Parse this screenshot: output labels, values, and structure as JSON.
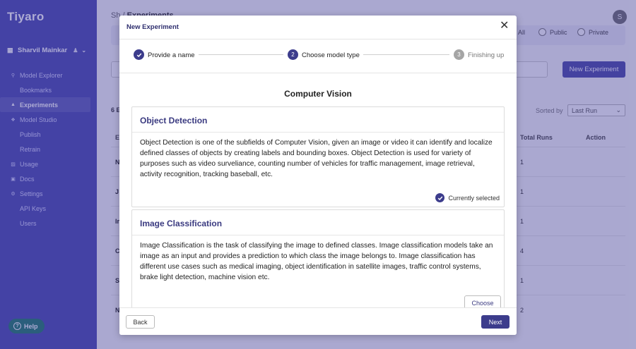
{
  "sidebar": {
    "brand": "Tiyaro",
    "user_name": "Sharvil Mainkar",
    "user_icon": "building-icon",
    "nav": [
      {
        "label": "Model Explorer",
        "icon": "search-icon",
        "sub": false,
        "active": false
      },
      {
        "label": "Bookmarks",
        "icon": "",
        "sub": true,
        "active": false
      },
      {
        "label": "Experiments",
        "icon": "flask-icon",
        "sub": false,
        "active": true
      },
      {
        "label": "Model Studio",
        "icon": "studio-icon",
        "sub": false,
        "active": false
      },
      {
        "label": "Publish",
        "icon": "",
        "sub": true,
        "active": false
      },
      {
        "label": "Retrain",
        "icon": "",
        "sub": true,
        "active": false
      },
      {
        "label": "Usage",
        "icon": "usage-icon",
        "sub": false,
        "active": false
      },
      {
        "label": "Docs",
        "icon": "docs-icon",
        "sub": false,
        "active": false
      },
      {
        "label": "Settings",
        "icon": "gear-icon",
        "sub": false,
        "active": false
      },
      {
        "label": "API Keys",
        "icon": "",
        "sub": true,
        "active": false
      },
      {
        "label": "Users",
        "icon": "",
        "sub": true,
        "active": false
      }
    ],
    "help_label": "Help"
  },
  "background": {
    "crumb_1": "Sh",
    "crumb_2": "Experiments",
    "avatar_initial": "S",
    "filters": [
      "All",
      "Public",
      "Private"
    ],
    "new_experiment_label": "New Experiment",
    "count_label": "6 E",
    "sort_label": "Sorted by",
    "sort_value": "Last Run",
    "columns": {
      "first": "E",
      "total_runs": "Total Runs",
      "action": "Action"
    },
    "rows": [
      {
        "first": "N",
        "runs": "1"
      },
      {
        "first": "J",
        "runs": "1"
      },
      {
        "first": "In",
        "runs": "1"
      },
      {
        "first": "C",
        "runs": "4"
      },
      {
        "first": "S",
        "runs": "1"
      },
      {
        "first": "N",
        "runs": "2"
      }
    ]
  },
  "modal": {
    "title": "New Experiment",
    "steps": [
      {
        "num": "1",
        "label": "Provide a name",
        "state": "done"
      },
      {
        "num": "2",
        "label": "Choose model type",
        "state": "current"
      },
      {
        "num": "3",
        "label": "Finishing up",
        "state": "todo"
      }
    ],
    "section_title": "Computer Vision",
    "cards": [
      {
        "title": "Object Detection",
        "description": "Object Detection is one of the subfields of Computer Vision, given an image or video it can identify and localize defined classes of objects by creating labels and bounding boxes. Object Detection is used for variety of purposes such as video surveliance, counting number of vehicles for traffic management, image retrieval, activity recognition, tracking baseball, etc.",
        "selected": true,
        "selected_label": "Currently selected"
      },
      {
        "title": "Image Classification",
        "description": "Image Classification is the task of classifying the image to defined classes. Image classification models take an image as an input and provides a prediction to which class the image belongs to. Image classification has different use cases such as medical imaging, object identification in satellite images, traffic control systems, brake light detection, machine vision etc.",
        "selected": false,
        "choose_label": "Choose"
      }
    ],
    "back_label": "Back",
    "next_label": "Next"
  },
  "colors": {
    "sidebar": "#4b4ab0",
    "accent": "#3c3c8c",
    "help": "#1f7a6a"
  }
}
